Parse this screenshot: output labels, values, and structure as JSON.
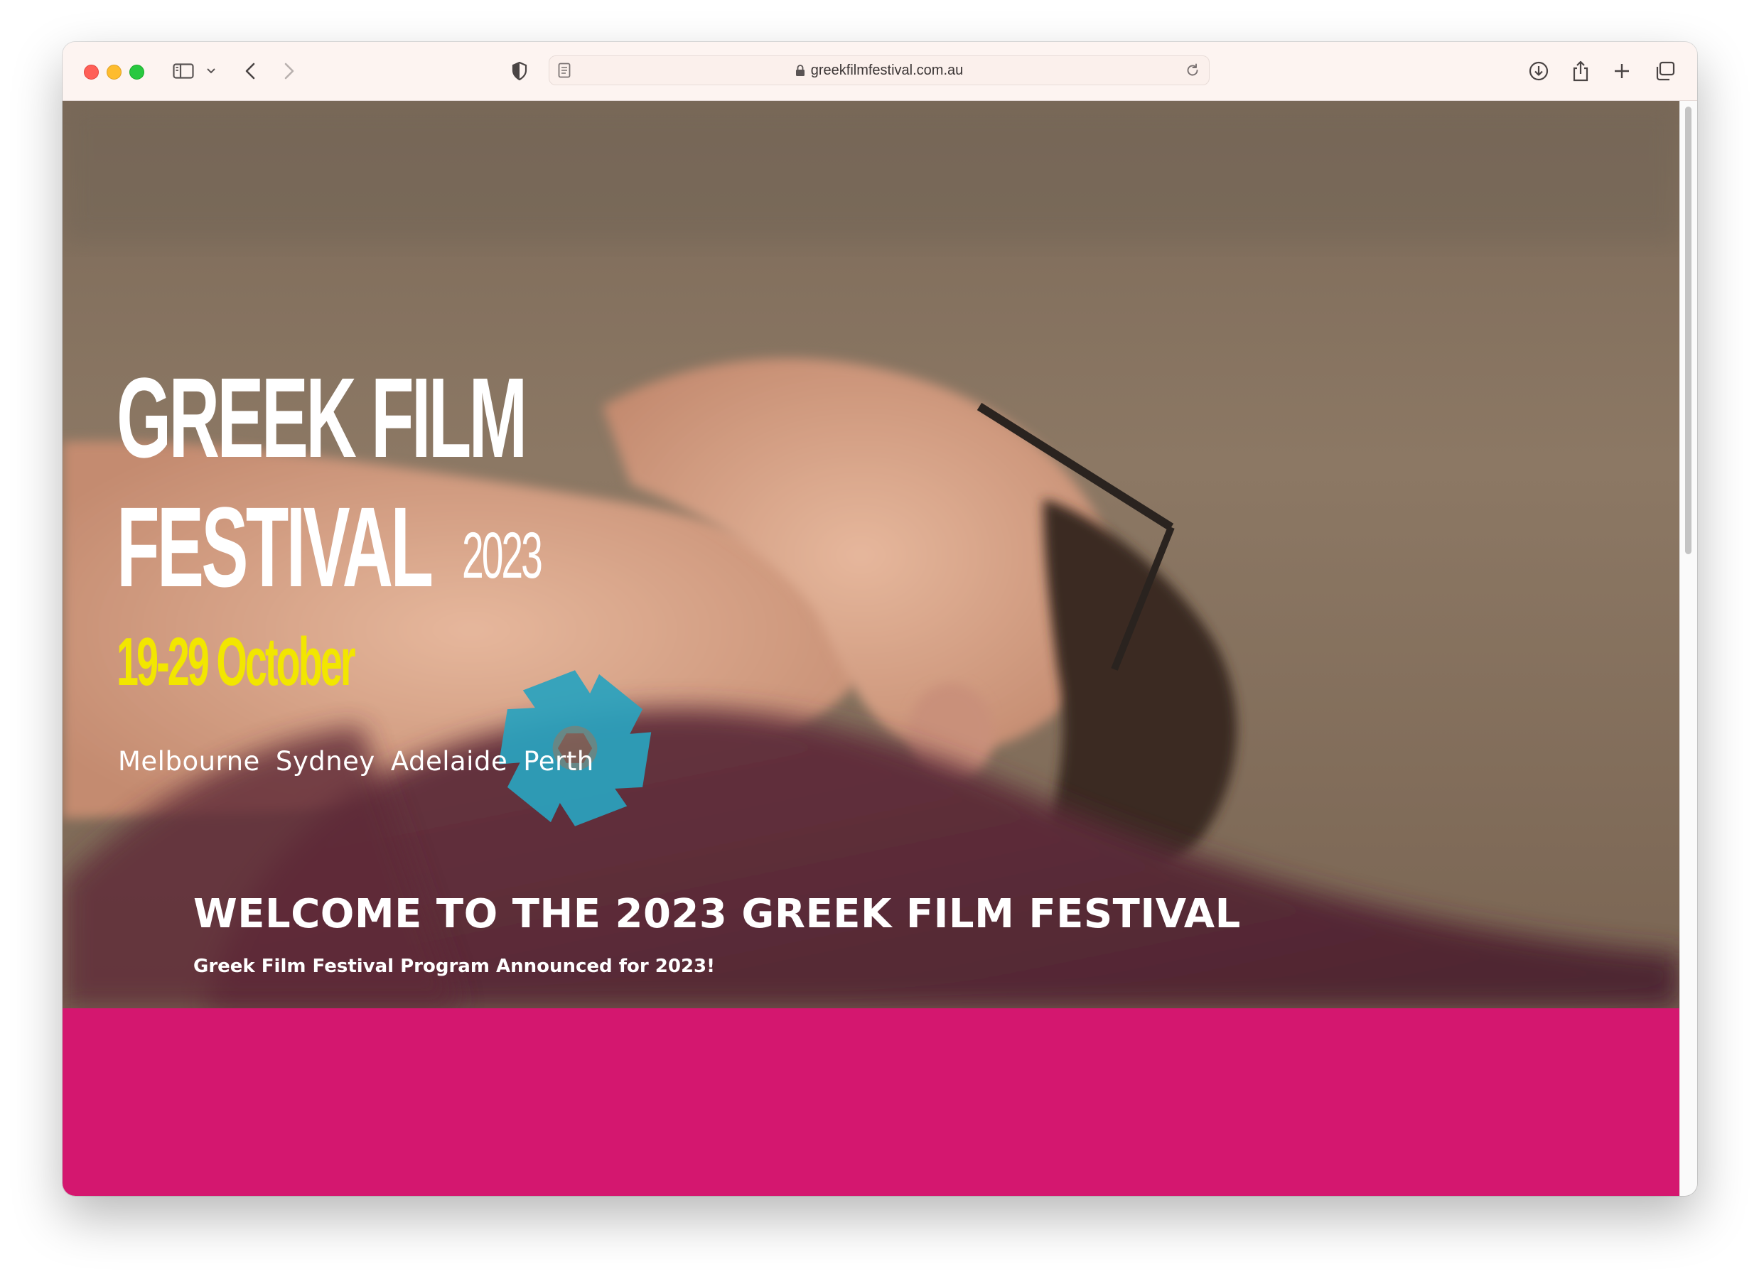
{
  "browser": {
    "url": "greekfilmfestival.com.au",
    "icons": [
      "sidebar-icon",
      "chevron-down-icon",
      "back-icon",
      "forward-icon",
      "shield-icon",
      "reader-icon",
      "lock-icon",
      "reload-icon",
      "download-icon",
      "share-icon",
      "new-tab-icon",
      "tabs-overview-icon"
    ]
  },
  "hero": {
    "logo_line1": "GREEK FILM",
    "logo_line2": "FESTIVAL",
    "logo_year": "2023",
    "dates": "19-29 October",
    "cities": [
      "Melbourne",
      "Sydney",
      "Adelaide",
      "Perth"
    ]
  },
  "welcome": {
    "heading": "WELCOME TO THE 2023 GREEK FILM FESTIVAL",
    "subheading": "Greek Film Festival Program Announced for 2023!"
  },
  "colors": {
    "brand_magenta": "#d4176f",
    "date_yellow": "#f2e600",
    "aperture_teal": "#2aa3bf"
  }
}
